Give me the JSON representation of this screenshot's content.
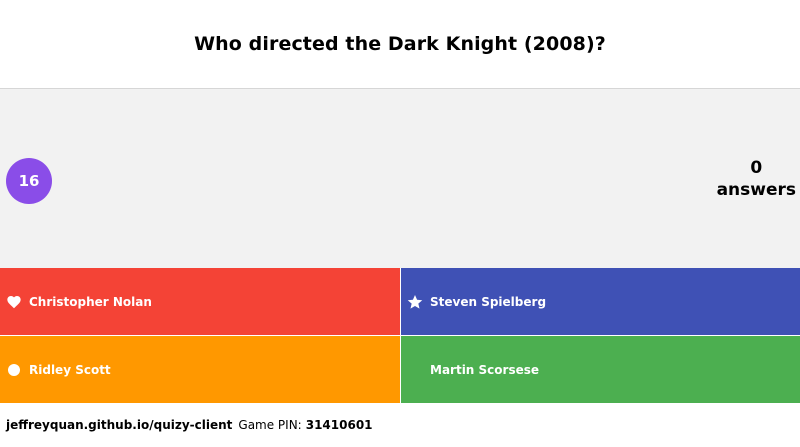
{
  "question": {
    "text": "Who directed the Dark Knight (2008)?"
  },
  "timer": {
    "value": "16",
    "color": "#8a4de8"
  },
  "answer_count": {
    "number": "0",
    "label": "answers"
  },
  "answers": [
    {
      "label": "Christopher Nolan",
      "icon": "heart-icon",
      "color": "#f44336"
    },
    {
      "label": "Steven Spielberg",
      "icon": "star-icon",
      "color": "#3f51b5"
    },
    {
      "label": "Ridley Scott",
      "icon": "circle-icon",
      "color": "#ff9800"
    },
    {
      "label": "Martin Scorsese",
      "icon": "moon-icon",
      "color": "#4caf50"
    }
  ],
  "footer": {
    "site": "jeffreyquan.github.io/quizy-client",
    "pin_label": "Game PIN:",
    "pin_value": "31410601"
  }
}
